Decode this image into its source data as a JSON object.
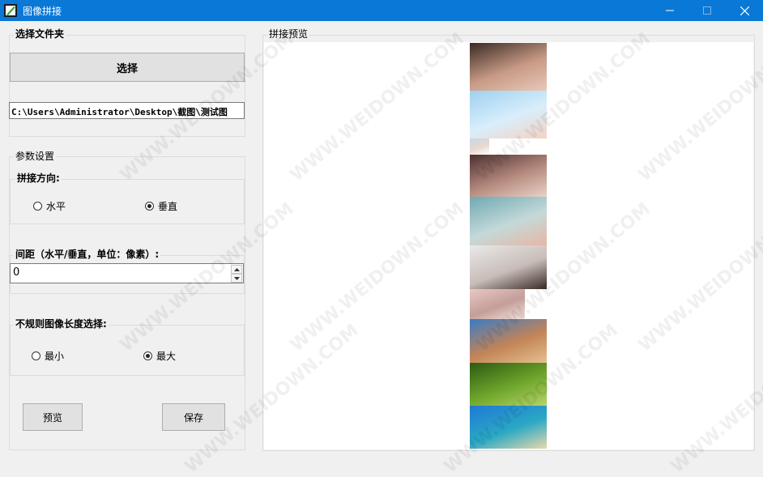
{
  "window": {
    "title": "图像拼接",
    "minimize_label": "minimize",
    "maximize_label": "maximize",
    "close_label": "close"
  },
  "folder_group": {
    "label": "选择文件夹",
    "select_button": "选择",
    "path_value": "C:\\Users\\Administrator\\Desktop\\截图\\测试图"
  },
  "params_group": {
    "label": "参数设置",
    "direction": {
      "label": "拼接方向:",
      "options": [
        {
          "label": "水平",
          "checked": false
        },
        {
          "label": "垂直",
          "checked": true
        }
      ]
    },
    "spacing": {
      "label": "间距（水平/垂直，单位：像素）:",
      "value": "0"
    },
    "irregular": {
      "label": "不规则图像长度选择:",
      "options": [
        {
          "label": "最小",
          "checked": false
        },
        {
          "label": "最大",
          "checked": true
        }
      ]
    }
  },
  "actions": {
    "preview_button": "预览",
    "save_button": "保存"
  },
  "preview_group": {
    "label": "拼接预览",
    "images": [
      {
        "name": "portrait-girl-hand",
        "colors": [
          "#3a2a24",
          "#c79a85",
          "#e8c8b8"
        ]
      },
      {
        "name": "girl-blue-dress",
        "colors": [
          "#9fd0ef",
          "#d8eefb",
          "#f4d3c4"
        ]
      },
      {
        "name": "small-thumbnail",
        "colors": [
          "#c7d7e6",
          "#e9d9cf",
          "#ffffff"
        ]
      },
      {
        "name": "girl-lying-sofa",
        "colors": [
          "#4d3030",
          "#b78c80",
          "#e8d2c8"
        ]
      },
      {
        "name": "girl-pool",
        "colors": [
          "#6fa9b2",
          "#c4d9d9",
          "#e7b6a4"
        ]
      },
      {
        "name": "girl-white-bed",
        "colors": [
          "#e9e9e9",
          "#c8bdb8",
          "#3a2b26"
        ]
      },
      {
        "name": "girl-pink-bg",
        "colors": [
          "#e8c8c5",
          "#c49e98",
          "#f3e2e1"
        ]
      },
      {
        "name": "desert-rock",
        "colors": [
          "#3b7bc4",
          "#c38457",
          "#e4c08e"
        ]
      },
      {
        "name": "green-forest",
        "colors": [
          "#2d5a12",
          "#6fa62c",
          "#b6d36a"
        ]
      },
      {
        "name": "tropical-beach",
        "colors": [
          "#1f78d6",
          "#2aa8c4",
          "#e9d8ac"
        ]
      }
    ]
  },
  "watermark": "WWW.WEIDOWN.COM"
}
